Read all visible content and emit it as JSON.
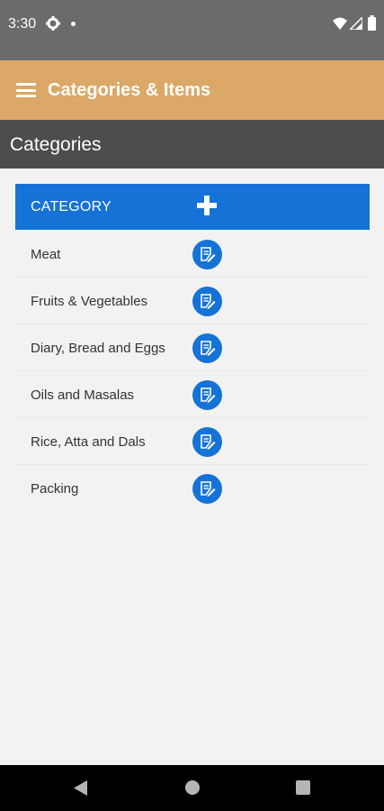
{
  "status_bar": {
    "time": "3:30",
    "icons": [
      "gear-icon",
      "notification-dot-icon",
      "wifi-icon",
      "signal-icon",
      "battery-icon"
    ]
  },
  "app_bar": {
    "title": "Categories & Items",
    "background": "#dba868",
    "menu_icon": "hamburger-menu-icon"
  },
  "section": {
    "title": "Categories",
    "background": "#4d4d4d"
  },
  "table": {
    "header_label": "CATEGORY",
    "header_background": "#1572d6",
    "add_icon": "plus-icon",
    "edit_icon": "edit-note-icon",
    "rows": [
      {
        "label": "Meat"
      },
      {
        "label": "Fruits & Vegetables"
      },
      {
        "label": "Diary, Bread and Eggs"
      },
      {
        "label": "Oils and Masalas"
      },
      {
        "label": "Rice, Atta and Dals"
      },
      {
        "label": "Packing"
      }
    ]
  },
  "nav_bar": {
    "icons": [
      "back-icon",
      "home-icon",
      "recents-icon"
    ]
  }
}
